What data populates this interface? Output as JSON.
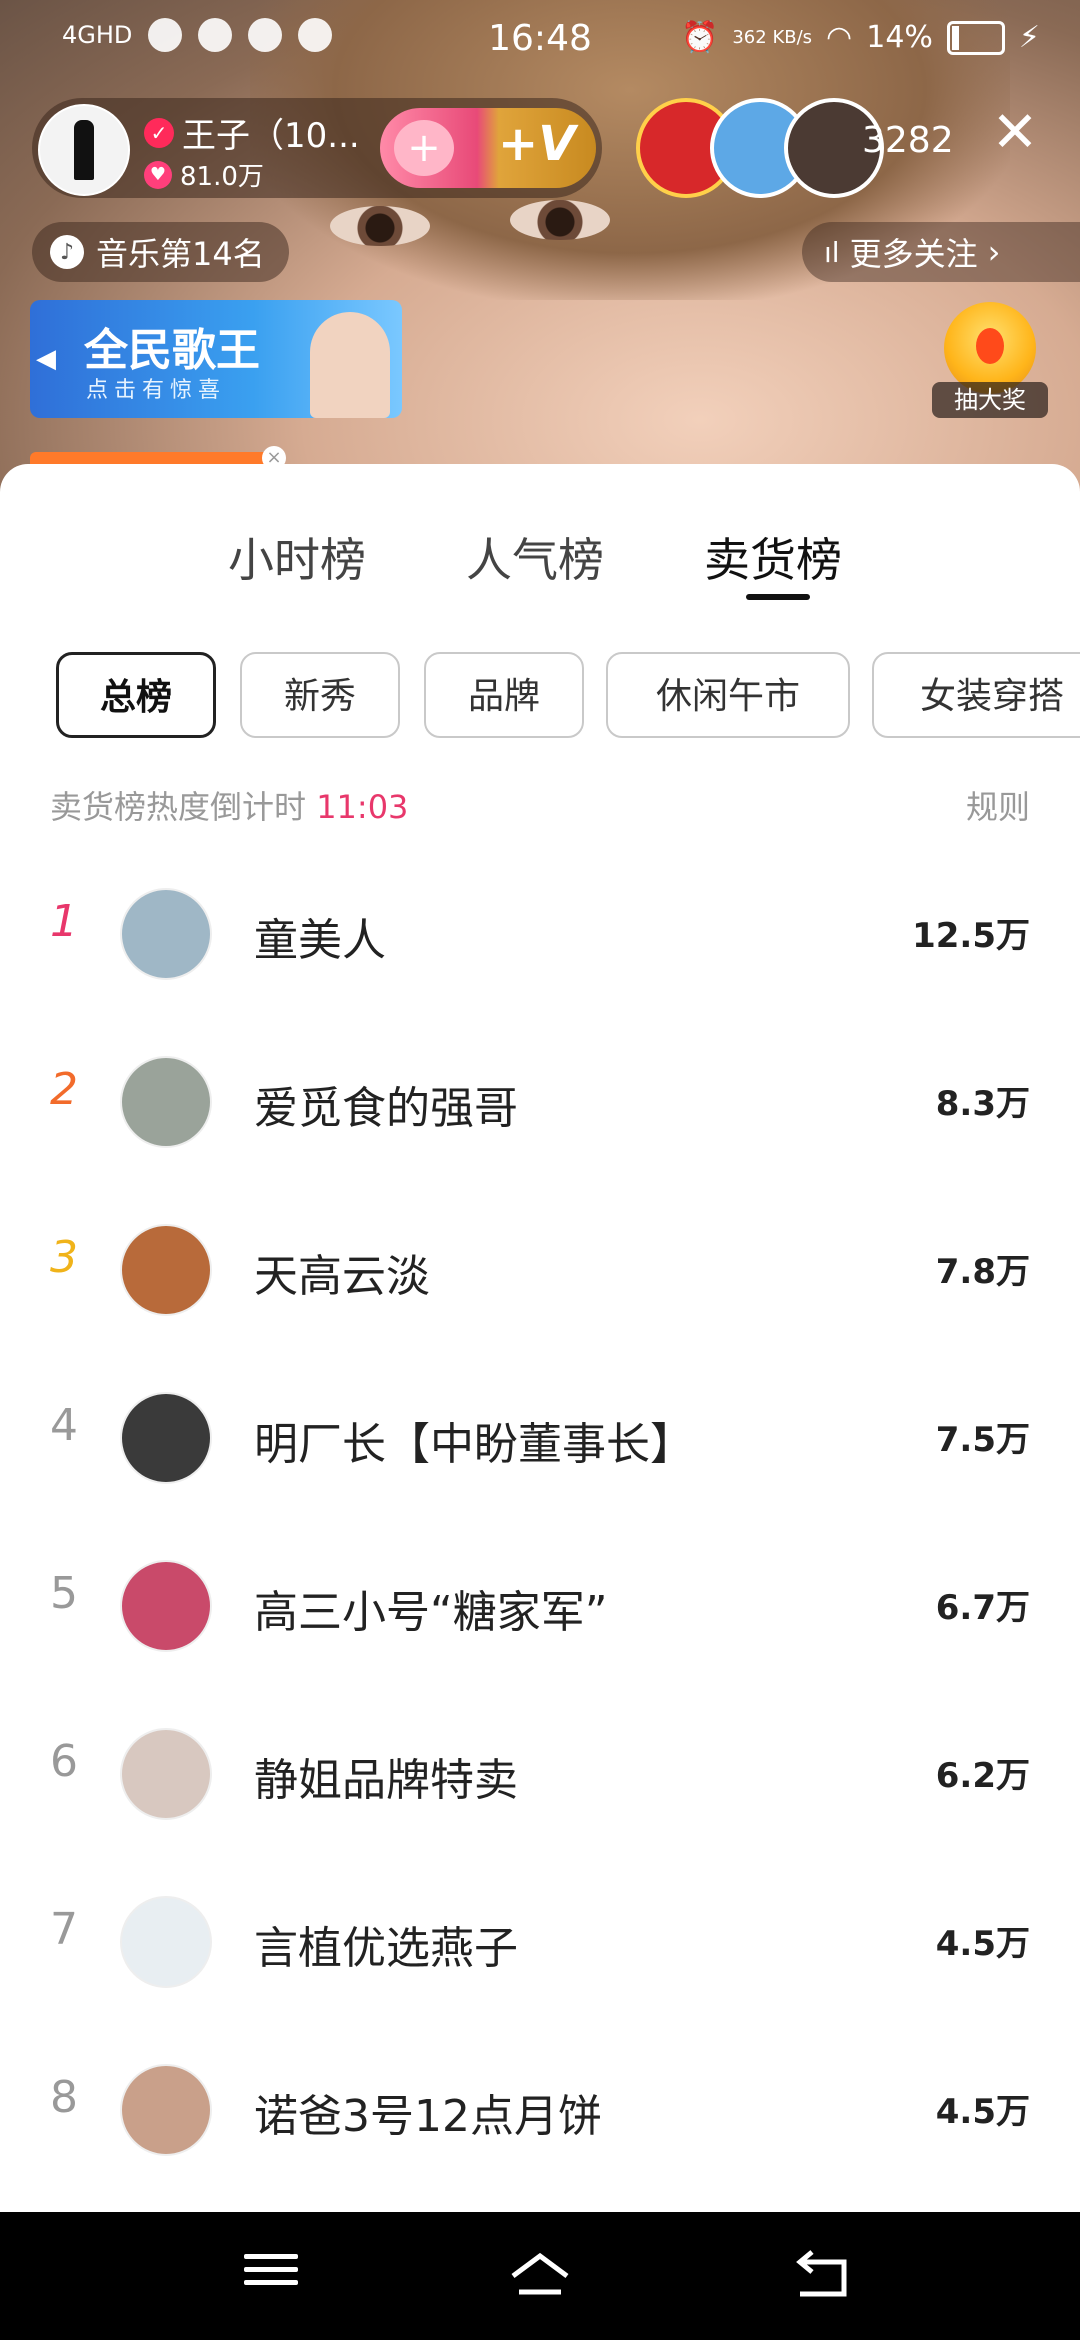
{
  "status_bar": {
    "network": "4GHD",
    "time": "16:48",
    "speed": "362 KB/s",
    "battery": "14%"
  },
  "host": {
    "name": "王子（10...",
    "likes": "81.0万",
    "plus_label": "+V"
  },
  "viewers": {
    "count": "3282"
  },
  "rank_chip": "音乐第14名",
  "more_follow": "更多关注",
  "banner": {
    "title": "全民歌王",
    "subtitle": "点击有惊喜"
  },
  "lottery_label": "抽大奖",
  "tabs": [
    {
      "label": "小时榜",
      "active": false
    },
    {
      "label": "人气榜",
      "active": false
    },
    {
      "label": "卖货榜",
      "active": true
    }
  ],
  "categories": [
    {
      "label": "总榜",
      "active": true
    },
    {
      "label": "新秀",
      "active": false
    },
    {
      "label": "品牌",
      "active": false
    },
    {
      "label": "休闲午市",
      "active": false
    },
    {
      "label": "女装穿搭",
      "active": false
    }
  ],
  "countdown": {
    "label": "卖货榜热度倒计时",
    "time": "11:03"
  },
  "rules_label": "规则",
  "rankings": [
    {
      "rank": "1",
      "name": "童美人",
      "value": "12.5万",
      "avatar_color": "#9fb7c6"
    },
    {
      "rank": "2",
      "name": "爱觅食的强哥",
      "value": "8.3万",
      "avatar_color": "#9aa39a"
    },
    {
      "rank": "3",
      "name": "天高云淡",
      "value": "7.8万",
      "avatar_color": "#b86a3a"
    },
    {
      "rank": "4",
      "name": "明厂长【中盼董事长】",
      "value": "7.5万",
      "avatar_color": "#3a3a3a"
    },
    {
      "rank": "5",
      "name": "高三小号“糖家军”",
      "value": "6.7万",
      "avatar_color": "#c94a6a"
    },
    {
      "rank": "6",
      "name": "静姐品牌特卖",
      "value": "6.2万",
      "avatar_color": "#d8c8c0"
    },
    {
      "rank": "7",
      "name": "言植优选燕子",
      "value": "4.5万",
      "avatar_color": "#e8eef2"
    },
    {
      "rank": "8",
      "name": "诺爸3号12点月饼",
      "value": "4.5万",
      "avatar_color": "#c9a08a"
    }
  ]
}
